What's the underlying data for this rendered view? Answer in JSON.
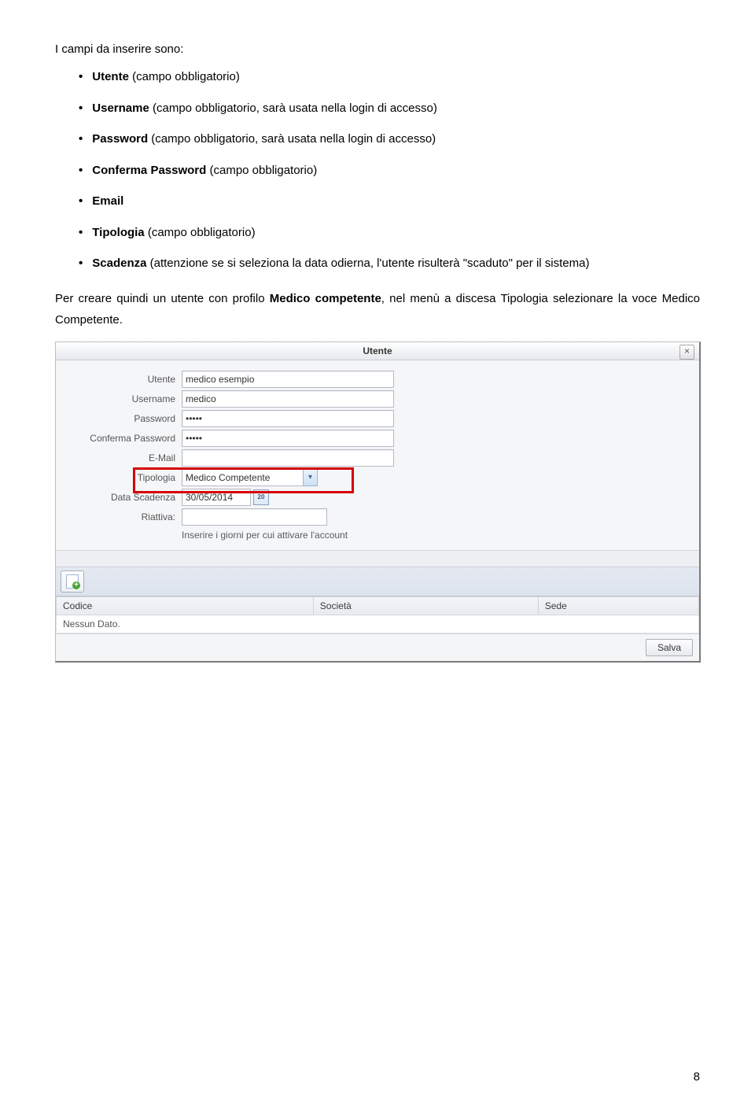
{
  "intro": "I campi da inserire sono:",
  "bullets": [
    {
      "pre": "",
      "strong": "Utente",
      "post": " (campo obbligatorio)"
    },
    {
      "pre": "",
      "strong": "Username",
      "post": " (campo obbligatorio, sarà usata nella login di accesso)"
    },
    {
      "pre": "",
      "strong": "Password",
      "post": " (campo obbligatorio, sarà usata nella login di accesso)"
    },
    {
      "pre": "",
      "strong": "Conferma Password",
      "post": " (campo obbligatorio)"
    },
    {
      "pre": "",
      "strong": "Email",
      "post": ""
    },
    {
      "pre": "",
      "strong": "Tipologia",
      "post": " (campo obbligatorio)"
    },
    {
      "pre": "",
      "strong": "Scadenza",
      "post": " (attenzione se si seleziona la data odierna, l'utente risulterà \"scaduto\" per il sistema)"
    }
  ],
  "after1": "Per creare quindi un utente con profilo ",
  "after_strong": "Medico competente",
  "after2": ", nel menù a discesa Tipologia selezionare la voce Medico Competente.",
  "dialog": {
    "title": "Utente",
    "close": "×",
    "labels": {
      "utente": "Utente",
      "username": "Username",
      "password": "Password",
      "conferma": "Conferma Password",
      "email": "E-Mail",
      "tipologia": "Tipologia",
      "scadenza": "Data Scadenza",
      "riattiva": "Riattiva:"
    },
    "values": {
      "utente": "medico esempio",
      "username": "medico",
      "password_mask": "•••••",
      "conferma_mask": "•••••",
      "email": "",
      "tipologia": "Medico Competente",
      "scadenza": "30/05/2014",
      "riattiva": ""
    },
    "calendar_glyph": "20",
    "hint": "Inserire i giorni per cui attivare l'account",
    "table": {
      "headers": [
        "Codice",
        "Società",
        "Sede"
      ],
      "empty": "Nessun Dato."
    },
    "save": "Salva"
  },
  "page_number": "8"
}
